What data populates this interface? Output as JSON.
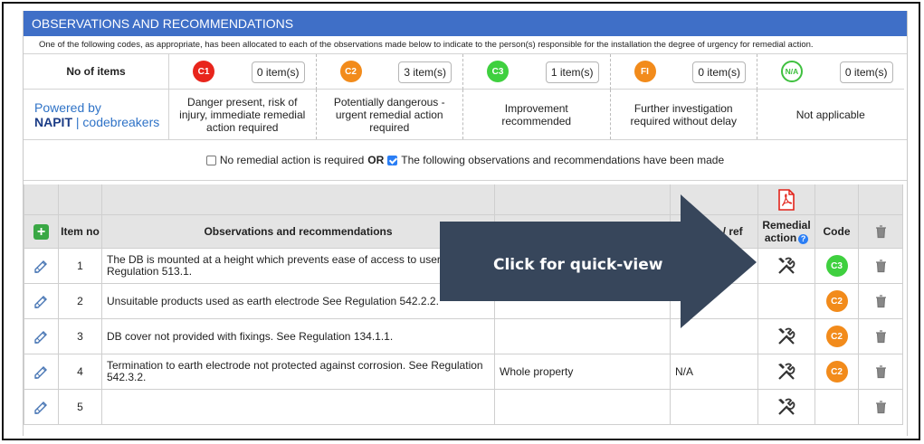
{
  "section_title": "OBSERVATIONS AND RECOMMENDATIONS",
  "note": "One of the following codes, as appropriate, has been allocated to each of the observations made below to indicate to the person(s) responsible for the installation the degree of urgency for remedial action.",
  "no_of_items_label": "No of items",
  "codes": [
    {
      "badge": "C1",
      "count": "0 item(s)",
      "desc": "Danger present, risk of injury, immediate remedial action required",
      "color": "#e8251c"
    },
    {
      "badge": "C2",
      "count": "3 item(s)",
      "desc": "Potentially dangerous - urgent remedial action required",
      "color": "#f28b1b"
    },
    {
      "badge": "C3",
      "count": "1 item(s)",
      "desc": "Improvement recommended",
      "color": "#3fd03f"
    },
    {
      "badge": "FI",
      "count": "0 item(s)",
      "desc": "Further investigation required without delay",
      "color": "#f28b1b"
    },
    {
      "badge": "N/A",
      "count": "0 item(s)",
      "desc": "Not applicable",
      "color": "#3fc03f"
    }
  ],
  "powered": {
    "line1": "Powered by",
    "brand": "NAPIT",
    "product": "codebreakers"
  },
  "checks": {
    "no_action": "No remedial action is required",
    "or": "OR",
    "made": "The following observations and recommendations have been made",
    "no_action_checked": false,
    "made_checked": true
  },
  "table": {
    "headers": {
      "item_no": "Item no",
      "observations": "Observations and recommendations",
      "circuit": "Circuit / ref",
      "remedial": "Remedial action",
      "code": "Code"
    },
    "rows": [
      {
        "no": "1",
        "obs": "The DB is mounted at a height which prevents ease of access to user. Regulation 513.1.",
        "location": "",
        "circuit": "",
        "remedial": true,
        "code": "C3",
        "code_color": "#3fd03f"
      },
      {
        "no": "2",
        "obs": "Unsuitable products used as earth electrode See Regulation 542.2.2.",
        "location": "",
        "circuit": "",
        "remedial": false,
        "code": "C2",
        "code_color": "#f28b1b"
      },
      {
        "no": "3",
        "obs": "DB cover not provided with fixings. See Regulation 134.1.1.",
        "location": "",
        "circuit": "",
        "remedial": true,
        "code": "C2",
        "code_color": "#f28b1b"
      },
      {
        "no": "4",
        "obs": "Termination to earth electrode not protected against corrosion. See Regulation 542.3.2.",
        "location": "Whole property",
        "circuit": "N/A",
        "remedial": true,
        "code": "C2",
        "code_color": "#f28b1b"
      },
      {
        "no": "5",
        "obs": "",
        "location": "",
        "circuit": "",
        "remedial": true,
        "code": "",
        "code_color": ""
      }
    ]
  },
  "callout": "Click for quick-view"
}
